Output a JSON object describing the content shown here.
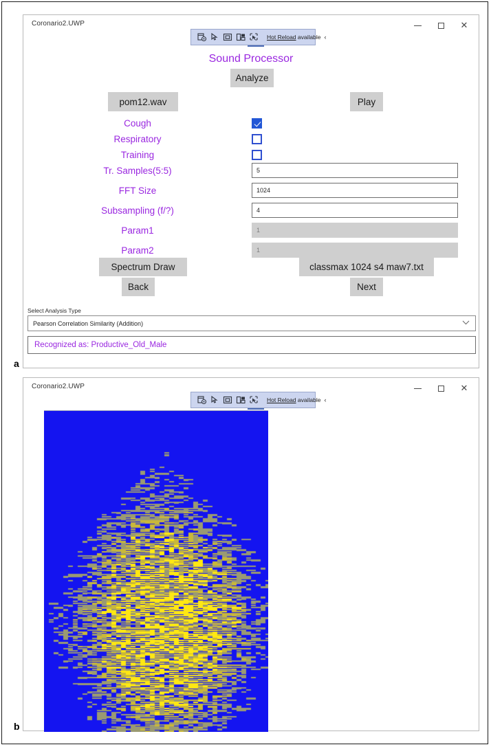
{
  "figure": {
    "panel_a_letter": "a",
    "panel_b_letter": "b"
  },
  "window_a": {
    "title": "Coronario2.UWP",
    "controls": {
      "minimize": "–",
      "maximize": "□",
      "close": "✕"
    },
    "hot_reload": {
      "label_underlined": "Hot Reload",
      "label_rest": " available",
      "chevron": "‹",
      "icons": [
        "hot-reload-settings-icon",
        "pointer-select-icon",
        "element-box-icon",
        "live-visual-tree-icon",
        "track-focus-icon"
      ]
    },
    "app_title": "Sound Processor",
    "buttons": {
      "analyze": "Analyze",
      "filename": "pom12.wav",
      "play": "Play",
      "spectrum_draw": "Spectrum Draw",
      "back": "Back",
      "classfile": "classmax  1024  s4  maw7.txt",
      "next": "Next"
    },
    "checkboxes": [
      {
        "label": "Cough",
        "checked": true
      },
      {
        "label": "Respiratory",
        "checked": false
      },
      {
        "label": "Training",
        "checked": false
      }
    ],
    "fields": [
      {
        "label": "Tr. Samples(5:5)",
        "value": "5",
        "disabled": false
      },
      {
        "label": "FFT Size",
        "value": "1024",
        "disabled": false
      },
      {
        "label": "Subsampling (f/?)",
        "value": "4",
        "disabled": false
      },
      {
        "label": "Param1",
        "value": "1",
        "disabled": true
      },
      {
        "label": "Param2",
        "value": "1",
        "disabled": true
      }
    ],
    "combo": {
      "caption": "Select Analysis Type",
      "selected": "Pearson Correlation Similarity (Addition)",
      "chevron": "⌄"
    },
    "result": {
      "text": "Recognized as: Productive_Old_Male"
    },
    "colors": {
      "accent_purple": "#9a27e0",
      "button_gray": "#cfcfcf",
      "checkbox_blue": "#2257d6",
      "hotbar_blue": "#ccd5ef"
    }
  },
  "window_b": {
    "title": "Coronario2.UWP",
    "controls": {
      "minimize": "–",
      "maximize": "□",
      "close": "✕"
    },
    "hot_reload": {
      "label_underlined": "Hot Reload",
      "label_rest": " available",
      "chevron": "‹",
      "icons": [
        "hot-reload-settings-icon",
        "pointer-select-icon",
        "element-box-icon",
        "live-visual-tree-icon",
        "track-focus-icon"
      ]
    },
    "spectrogram": {
      "description": "Spectrum draw output: blue background with yellow and gray horizontal energy bands",
      "background_color": "#1414f0",
      "high_color": "#ffe812",
      "mid_color": "#9a9a72"
    }
  }
}
